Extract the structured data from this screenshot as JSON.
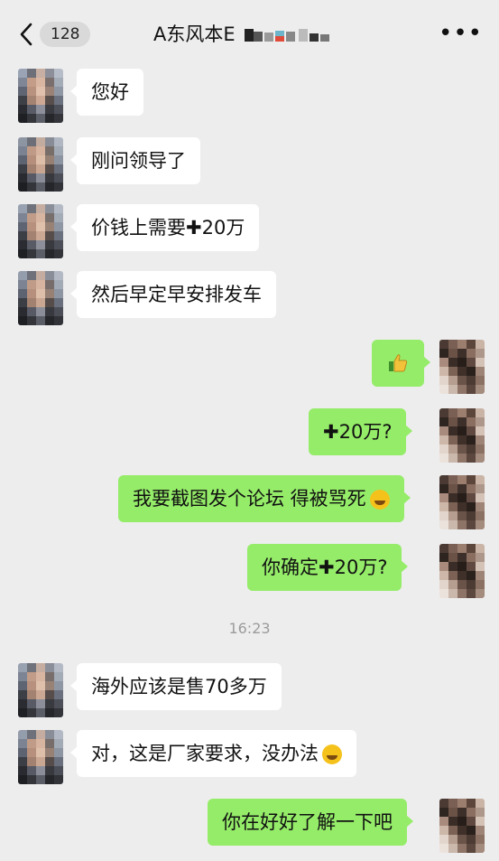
{
  "header": {
    "back_label": "<",
    "unread_count": "128",
    "title": "A东风本E",
    "more_label": "•••"
  },
  "messages": [
    {
      "side": "in",
      "text": "您好"
    },
    {
      "side": "in",
      "text": "刚问领导了"
    },
    {
      "side": "in",
      "text": "价钱上需要✚20万"
    },
    {
      "side": "in",
      "text": "然后早定早安排发车"
    },
    {
      "side": "out",
      "text": "",
      "emoji": "thumbs-up"
    },
    {
      "side": "out",
      "text": "✚20万?"
    },
    {
      "side": "out",
      "text": "我要截图发个论坛 得被骂死",
      "emoji": "laughing-crying"
    },
    {
      "side": "out",
      "text": "你确定✚20万?"
    },
    {
      "side": "in",
      "text": "海外应该是售70多万"
    },
    {
      "side": "in",
      "text": "对，这是厂家要求，没办法",
      "emoji": "laughing-crying"
    },
    {
      "side": "out",
      "text": "你在好好了解一下吧"
    }
  ],
  "timestamp": "16:23",
  "colors": {
    "background": "#ededed",
    "incoming_bubble": "#ffffff",
    "outgoing_bubble": "#95ec69"
  }
}
